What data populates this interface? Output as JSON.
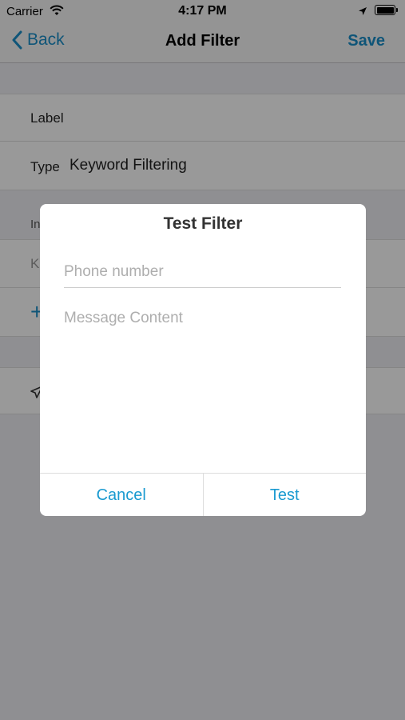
{
  "status_bar": {
    "carrier": "Carrier",
    "time": "4:17 PM",
    "icons": [
      "wifi-icon",
      "location-arrow-icon",
      "battery-icon"
    ]
  },
  "nav": {
    "back_label": "Back",
    "title": "Add Filter",
    "save_label": "Save",
    "accent_color": "#1a8ec9"
  },
  "form": {
    "label_row": "Label",
    "type_label": "Type",
    "type_value": "Keyword Filtering",
    "partial_section_header": "In",
    "partial_keyword_row": "K",
    "partial_add_glyph": "+"
  },
  "dialog": {
    "title": "Test Filter",
    "phone_placeholder": "Phone number",
    "message_placeholder": "Message Content",
    "cancel_label": "Cancel",
    "test_label": "Test"
  }
}
